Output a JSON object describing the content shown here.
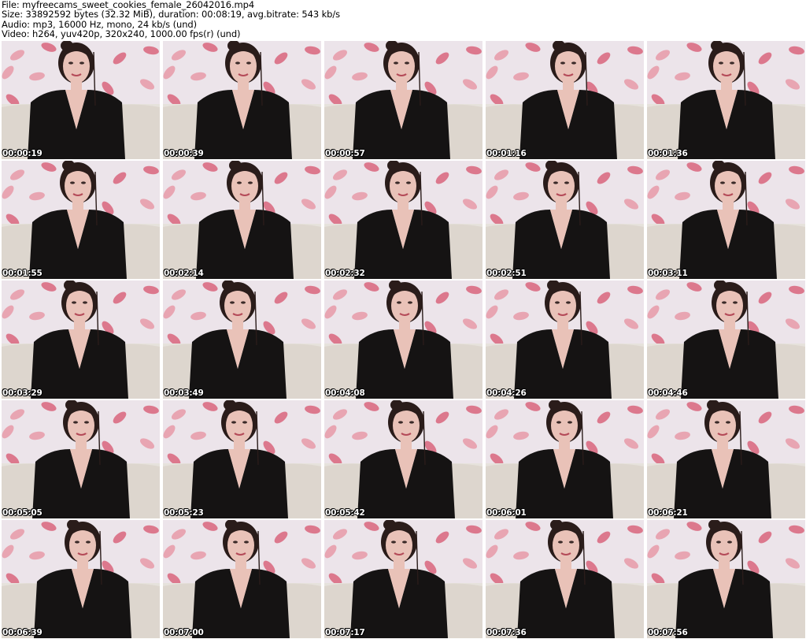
{
  "header": {
    "file_line": "File: myfreecams_sweet_cookies_female_26042016.mp4",
    "size_line": "Size: 33892592 bytes (32.32 MiB), duration: 00:08:19, avg.bitrate: 543 kb/s",
    "audio_line": "Audio: mp3, 16000 Hz, mono, 24 kb/s (und)",
    "video_line": "Video: h264, yuv420p, 320x240, 1000.00 fps(r) (und)"
  },
  "thumbnails": [
    "00:00:19",
    "00:00:39",
    "00:00:57",
    "00:01:16",
    "00:01:36",
    "00:01:55",
    "00:02:14",
    "00:02:32",
    "00:02:51",
    "00:03:11",
    "00:03:29",
    "00:03:49",
    "00:04:08",
    "00:04:26",
    "00:04:46",
    "00:05:05",
    "00:05:23",
    "00:05:42",
    "00:06:01",
    "00:06:21",
    "00:06:39",
    "00:07:00",
    "00:07:17",
    "00:07:36",
    "00:07:56"
  ],
  "colors": {
    "wallpaper": "#ece4ea",
    "leaf": "#d9657c",
    "leaf_light": "#e89aa8",
    "sofa": "#e6e2dc",
    "skin": "#e9c2b8",
    "hair": "#2a1c1a",
    "top": "#151313"
  }
}
